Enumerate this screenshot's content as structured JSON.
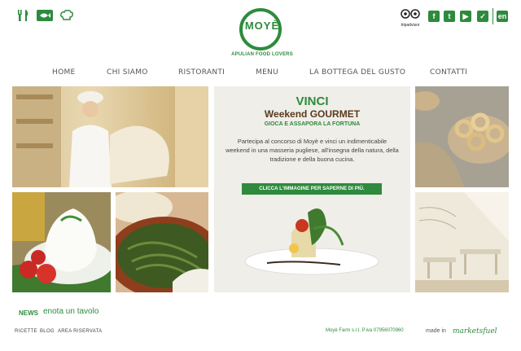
{
  "header": {
    "left_icons": [
      "cutlery-icon",
      "fish-icon",
      "chef-hat-icon"
    ],
    "logo": {
      "text": "MOYÈ",
      "tagline": "APULIAN FOOD LOVERS"
    },
    "tripadvisor_label": "tripadvisor",
    "social_icons": [
      "facebook-icon",
      "twitter-icon",
      "youtube-icon",
      "check-icon"
    ],
    "lang_label": "en"
  },
  "nav": {
    "items": [
      "HOME",
      "CHI SIAMO",
      "RISTORANTI",
      "MENU",
      "LA BOTTEGA DEL GUSTO",
      "CONTATTI"
    ]
  },
  "promo": {
    "title": "VINCI",
    "subtitle": "Weekend GOURMET",
    "tagline": "GIOCA E ASSAPORA LA FORTUNA",
    "body": "Partecipa al concorso di Moyè e vinci un indimenticabile weekend in una masseria pugliese, all'insegna della natura, della tradizione e della buona cucina.",
    "cta": "CLICCA L'IMMAGINE PER SAPERNE DI PIÙ."
  },
  "news": {
    "label": "NEWS",
    "link": "enota un tavolo"
  },
  "footer": {
    "links": [
      "RICETTE",
      "BLOG",
      "AREA RISERVATA"
    ],
    "company": "Moyè Farm s.r.l. P.iva 07956070960",
    "made_in": "made in",
    "signature": "marketsfuel"
  },
  "colors": {
    "brand_green": "#2e8b3d",
    "promo_bg": "#efeee9"
  }
}
